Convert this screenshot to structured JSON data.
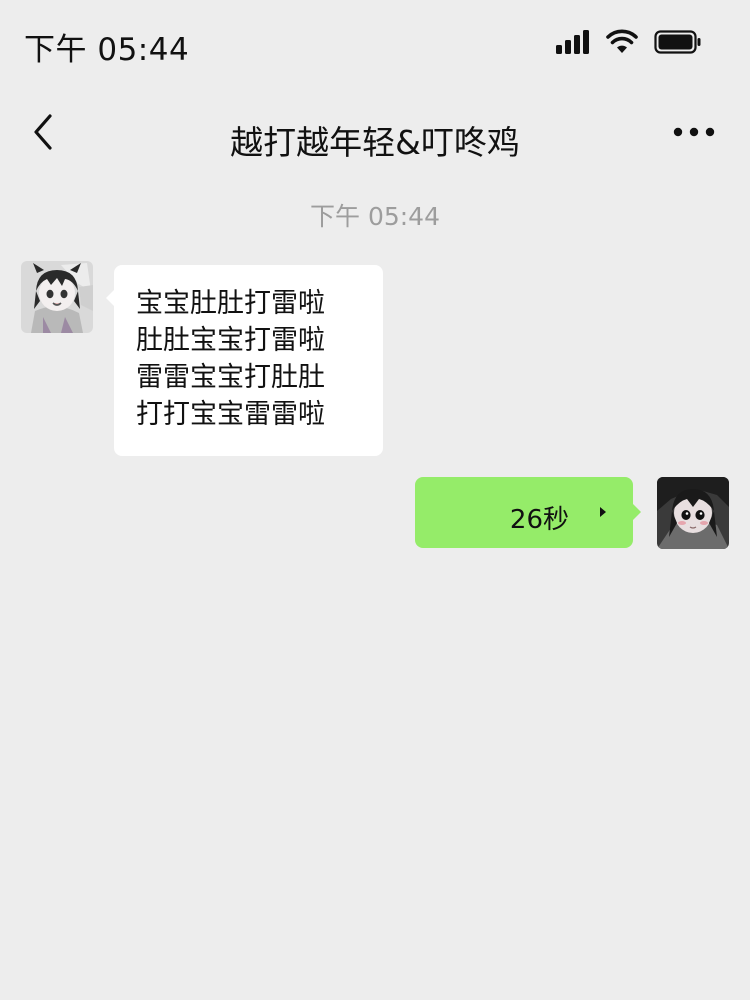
{
  "status_bar": {
    "time": "下午 05:44",
    "icons": [
      "signal-icon",
      "wifi-icon",
      "battery-icon"
    ]
  },
  "nav": {
    "title": "越打越年轻&叮咚鸡",
    "back_icon": "chevron-left-icon",
    "more_icon": "more-dots-icon"
  },
  "chat": {
    "timestamp": "下午 05:44",
    "messages": [
      {
        "direction": "incoming",
        "type": "text",
        "lines": [
          "宝宝肚肚打雷啦",
          "肚肚宝宝打雷啦",
          "雷雷宝宝打肚肚",
          "打打宝宝雷雷啦"
        ]
      },
      {
        "direction": "outgoing",
        "type": "voice",
        "duration": "26秒"
      }
    ]
  },
  "colors": {
    "background": "#ededed",
    "incoming_bubble": "#ffffff",
    "outgoing_bubble": "#95ec69",
    "timestamp": "#9d9d9d"
  }
}
